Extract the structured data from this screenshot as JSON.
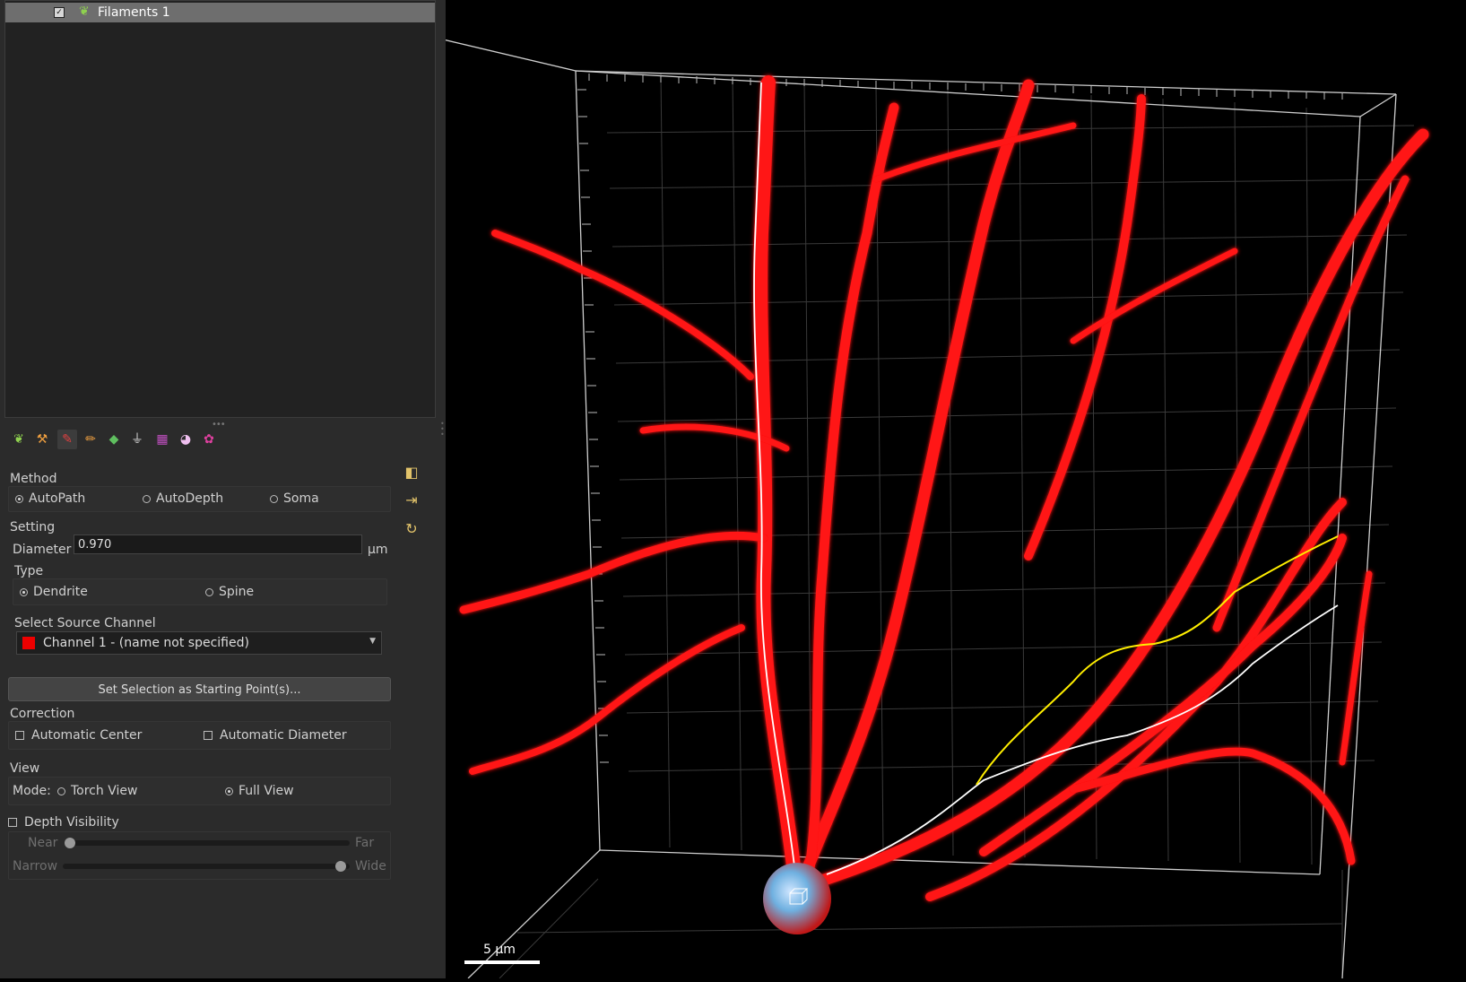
{
  "tree": {
    "item_label": "Filaments 1",
    "checked": true,
    "icon": "filament-leaf-icon"
  },
  "toolbar": {
    "icons": [
      "create-icon",
      "wand-icon",
      "pencil-red-icon",
      "pencil-orange-icon",
      "color-shape-icon",
      "filter-icon",
      "statistics-icon",
      "color-wheel-icon",
      "gear-icon"
    ]
  },
  "panel": {
    "method": {
      "title": "Method",
      "options": [
        "AutoPath",
        "AutoDepth",
        "Soma"
      ],
      "selected": "AutoPath"
    },
    "setting": {
      "title": "Setting",
      "diameter_label": "Diameter",
      "diameter_value": "0.970",
      "diameter_unit": "µm",
      "type_title": "Type",
      "type_options": [
        "Dendrite",
        "Spine"
      ],
      "type_selected": "Dendrite",
      "source_title": "Select Source Channel",
      "source_value": "Channel 1 - (name not specified)",
      "source_color": "#e00000"
    },
    "start_button": "Set Selection as Starting Point(s)...",
    "correction": {
      "title": "Correction",
      "automatic_center": "Automatic Center",
      "automatic_diameter": "Automatic Diameter"
    },
    "view": {
      "title": "View",
      "mode_label": "Mode:",
      "options": [
        "Torch View",
        "Full View"
      ],
      "selected": "Full View"
    },
    "depth": {
      "label": "Depth Visibility",
      "near": "Near",
      "far": "Far",
      "narrow": "Narrow",
      "wide": "Wide",
      "near_far_level": 0.0,
      "narrow_wide_level": 1.0
    }
  },
  "viewport": {
    "scale_label": "5 µm",
    "background": "#000000",
    "dendrite_color": "#ff1010",
    "trace_white": "#ffffff",
    "trace_yellow": "#ffee00",
    "soma_color": "#7fb8e6"
  }
}
